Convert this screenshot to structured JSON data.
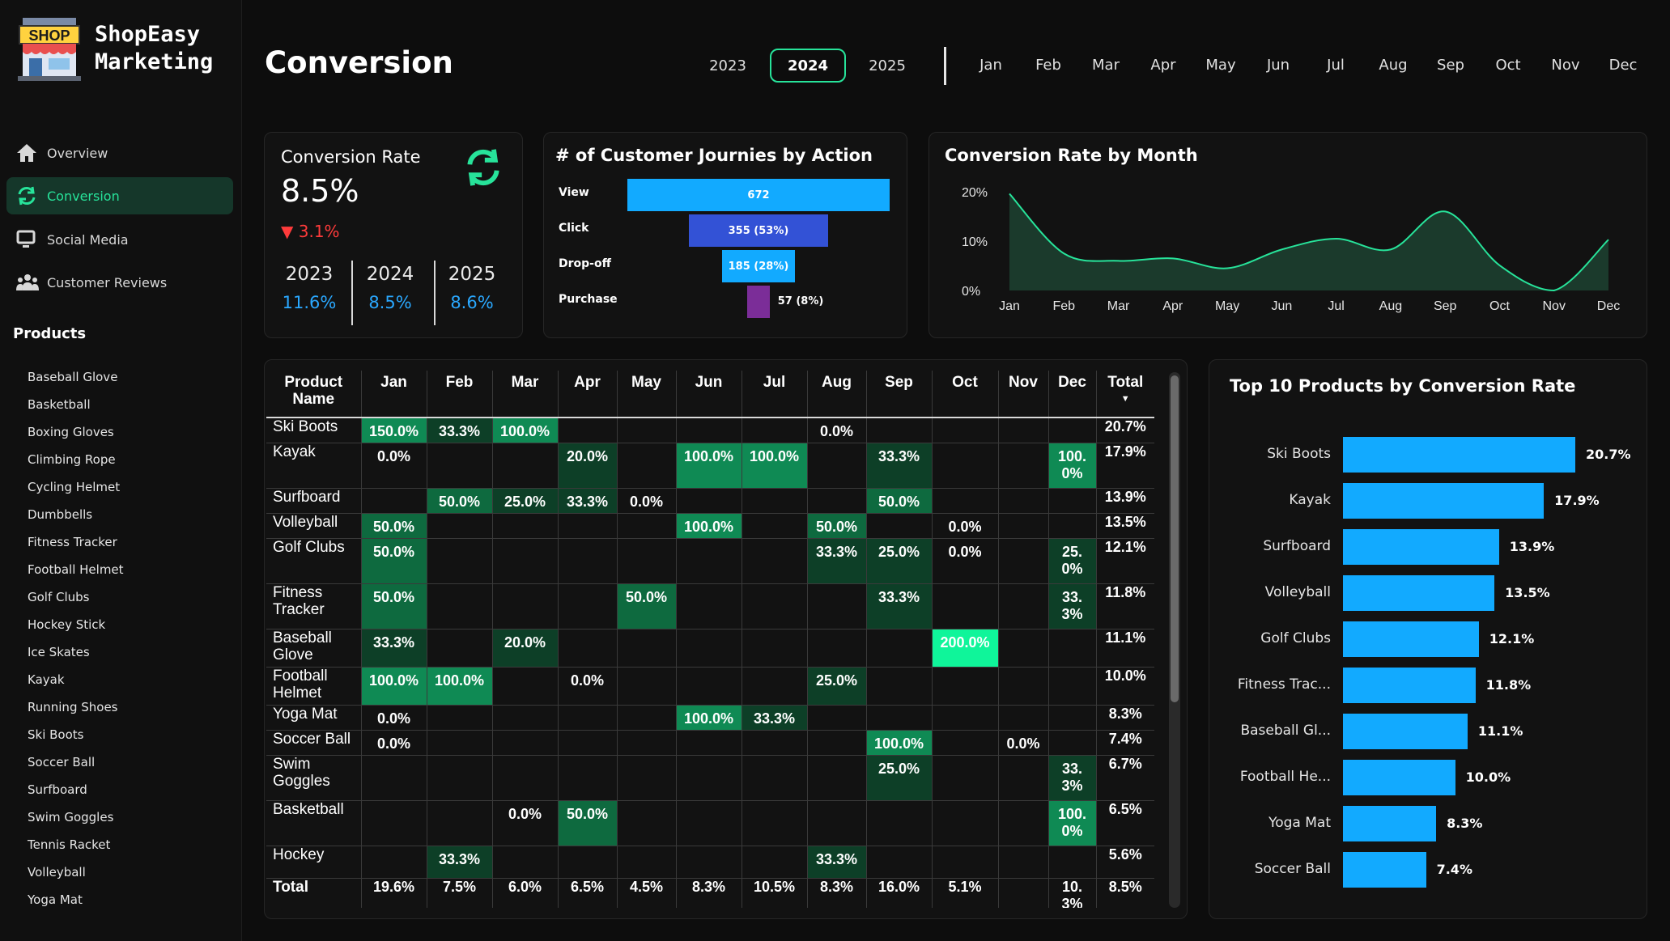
{
  "brand": {
    "logo_text": "SHOP",
    "line1": "ShopEasy",
    "line2": "Marketing"
  },
  "nav": [
    {
      "label": "Overview",
      "icon": "home-icon",
      "active": false
    },
    {
      "label": "Conversion",
      "icon": "refresh-icon",
      "active": true
    },
    {
      "label": "Social Media",
      "icon": "monitor-icon",
      "active": false
    },
    {
      "label": "Customer Reviews",
      "icon": "users-icon",
      "active": false
    }
  ],
  "products_heading": "Products",
  "products": [
    "Baseball Glove",
    "Basketball",
    "Boxing Gloves",
    "Climbing Rope",
    "Cycling Helmet",
    "Dumbbells",
    "Fitness Tracker",
    "Football Helmet",
    "Golf Clubs",
    "Hockey Stick",
    "Ice Skates",
    "Kayak",
    "Running Shoes",
    "Ski Boots",
    "Soccer Ball",
    "Surfboard",
    "Swim Goggles",
    "Tennis Racket",
    "Volleyball",
    "Yoga Mat"
  ],
  "page_title": "Conversion",
  "years": [
    "2023",
    "2024",
    "2025"
  ],
  "selected_year": "2024",
  "months": [
    "Jan",
    "Feb",
    "Mar",
    "Apr",
    "May",
    "Jun",
    "Jul",
    "Aug",
    "Sep",
    "Oct",
    "Nov",
    "Dec"
  ],
  "kpi": {
    "title": "Conversion Rate",
    "value": "8.5%",
    "delta": "▼ 3.1%",
    "years": [
      {
        "year": "2023",
        "value": "11.6%"
      },
      {
        "year": "2024",
        "value": "8.5%"
      },
      {
        "year": "2025",
        "value": "8.6%"
      }
    ],
    "accent": "#27e39a",
    "value_color": "#2aa8ff",
    "negative_color": "#ff3b3b"
  },
  "funnel": {
    "title": "# of Customer Journies by Action",
    "rows": [
      {
        "label": "View",
        "value": 672,
        "text": "672",
        "color": "#12aaff"
      },
      {
        "label": "Click",
        "value": 355,
        "text": "355 (53%)",
        "color": "#3352d6"
      },
      {
        "label": "Drop-off",
        "value": 185,
        "text": "185 (28%)",
        "color": "#12aaff"
      },
      {
        "label": "Purchase",
        "value": 57,
        "text": "57 (8%)",
        "color": "#7b2d98"
      }
    ]
  },
  "chart_data": [
    {
      "type": "area",
      "title": "Conversion Rate by Month",
      "categories": [
        "Jan",
        "Feb",
        "Mar",
        "Apr",
        "May",
        "Jun",
        "Jul",
        "Aug",
        "Sep",
        "Oct",
        "Nov",
        "Dec"
      ],
      "values": [
        19.6,
        7.5,
        6.0,
        6.5,
        4.5,
        8.3,
        10.5,
        8.3,
        16.0,
        5.1,
        0,
        10.3
      ],
      "y_ticks": [
        "20%",
        "10%",
        "0%"
      ],
      "ylim": [
        0,
        20
      ],
      "line_color": "#27e39a"
    },
    {
      "type": "bar",
      "title": "Top 10 Products by Conversion Rate",
      "categories": [
        "Ski Boots",
        "Kayak",
        "Surfboard",
        "Volleyball",
        "Golf Clubs",
        "Fitness Trac...",
        "Baseball Gl...",
        "Football He...",
        "Yoga Mat",
        "Soccer Ball"
      ],
      "values": [
        20.7,
        17.9,
        13.9,
        13.5,
        12.1,
        11.8,
        11.1,
        10.0,
        8.3,
        7.4
      ],
      "labels": [
        "20.7%",
        "17.9%",
        "13.9%",
        "13.5%",
        "12.1%",
        "11.8%",
        "11.1%",
        "10.0%",
        "8.3%",
        "7.4%"
      ],
      "color": "#12aaff"
    },
    {
      "type": "table",
      "header_product": "Product Name",
      "header_total": "Total",
      "columns": [
        "Jan",
        "Feb",
        "Mar",
        "Apr",
        "May",
        "Jun",
        "Jul",
        "Aug",
        "Sep",
        "Oct",
        "Nov",
        "Dec"
      ],
      "rows": [
        {
          "name": "Ski Boots",
          "cells": [
            "150.0%",
            "33.3%",
            "100.0%",
            "",
            "",
            "",
            "",
            "0.0%",
            "",
            "",
            "",
            ""
          ],
          "total": "20.7%"
        },
        {
          "name": "Kayak",
          "cells": [
            "0.0%",
            "",
            "",
            "20.0%",
            "",
            "100.0%",
            "100.0%",
            "",
            "33.3%",
            "",
            "",
            "100.0%"
          ],
          "total": "17.9%"
        },
        {
          "name": "Surfboard",
          "cells": [
            "",
            "50.0%",
            "25.0%",
            "33.3%",
            "0.0%",
            "",
            "",
            "",
            "50.0%",
            "",
            "",
            ""
          ],
          "total": "13.9%"
        },
        {
          "name": "Volleyball",
          "cells": [
            "50.0%",
            "",
            "",
            "",
            "",
            "100.0%",
            "",
            "50.0%",
            "",
            "0.0%",
            "",
            ""
          ],
          "total": "13.5%"
        },
        {
          "name": "Golf Clubs",
          "cells": [
            "50.0%",
            "",
            "",
            "",
            "",
            "",
            "",
            "33.3%",
            "25.0%",
            "0.0%",
            "",
            "25.0%"
          ],
          "total": "12.1%"
        },
        {
          "name": "Fitness Tracker",
          "cells": [
            "50.0%",
            "",
            "",
            "",
            "50.0%",
            "",
            "",
            "",
            "33.3%",
            "",
            "",
            "33.3%"
          ],
          "total": "11.8%"
        },
        {
          "name": "Baseball Glove",
          "cells": [
            "33.3%",
            "",
            "20.0%",
            "",
            "",
            "",
            "",
            "",
            "",
            "200.0%",
            "",
            ""
          ],
          "total": "11.1%"
        },
        {
          "name": "Football Helmet",
          "cells": [
            "100.0%",
            "100.0%",
            "",
            "0.0%",
            "",
            "",
            "",
            "25.0%",
            "",
            "",
            "",
            ""
          ],
          "total": "10.0%"
        },
        {
          "name": "Yoga Mat",
          "cells": [
            "0.0%",
            "",
            "",
            "",
            "",
            "100.0%",
            "33.3%",
            "",
            "",
            "",
            "",
            ""
          ],
          "total": "8.3%"
        },
        {
          "name": "Soccer Ball",
          "cells": [
            "0.0%",
            "",
            "",
            "",
            "",
            "",
            "",
            "",
            "100.0%",
            "",
            "0.0%",
            ""
          ],
          "total": "7.4%"
        },
        {
          "name": "Swim Goggles",
          "cells": [
            "",
            "",
            "",
            "",
            "",
            "",
            "",
            "",
            "25.0%",
            "",
            "",
            "33.3%"
          ],
          "total": "6.7%"
        },
        {
          "name": "Basketball",
          "cells": [
            "",
            "",
            "0.0%",
            "50.0%",
            "",
            "",
            "",
            "",
            "",
            "",
            "",
            "100.0%"
          ],
          "total": "6.5%"
        },
        {
          "name": "Hockey",
          "cells": [
            "",
            "33.3%",
            "",
            "",
            "",
            "",
            "",
            "33.3%",
            "",
            "",
            "",
            ""
          ],
          "total": "5.6%"
        }
      ],
      "total_row": {
        "name": "Total",
        "cells": [
          "19.6%",
          "7.5%",
          "6.0%",
          "6.5%",
          "4.5%",
          "8.3%",
          "10.5%",
          "8.3%",
          "16.0%",
          "5.1%",
          "",
          "10.3%"
        ],
        "total": "8.5%"
      }
    }
  ]
}
